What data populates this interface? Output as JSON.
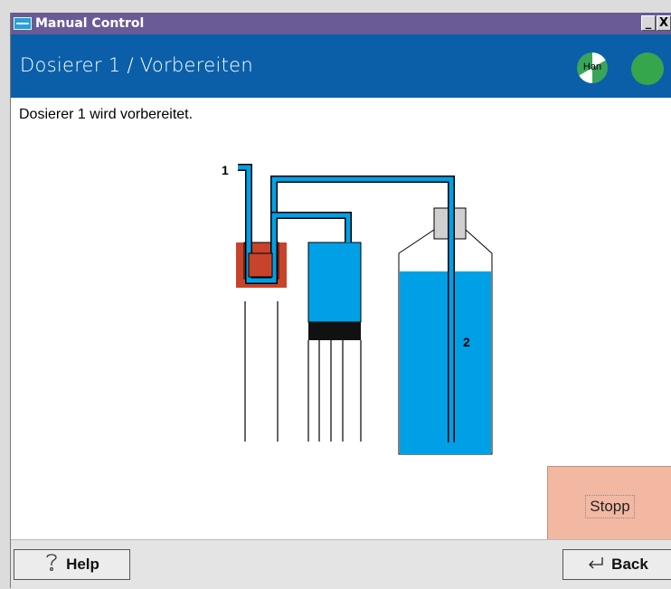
{
  "window": {
    "title": "Manual Control",
    "minimize_label": "_",
    "close_label": "X"
  },
  "header": {
    "title": "Dosierer 1 / Vorbereiten",
    "mode_label": "Han"
  },
  "message": "Dosierer 1 wird vorbereitet.",
  "diagram": {
    "label_1": "1",
    "label_2": "2"
  },
  "actions": {
    "stop_label": "Stopp"
  },
  "footer": {
    "help_label": "Help",
    "back_label": "Back"
  },
  "colors": {
    "title_bar": "#6a5a96",
    "header": "#0b5fa8",
    "liquid": "#00a0e6",
    "valve": "#c8432b",
    "status_ok": "#36a64d",
    "stop_button": "#f2b8a2"
  },
  "icons": {
    "help": "help-icon",
    "back": "back-arrow-icon",
    "mode": "hand-mode-icon",
    "status": "status-indicator-icon"
  }
}
